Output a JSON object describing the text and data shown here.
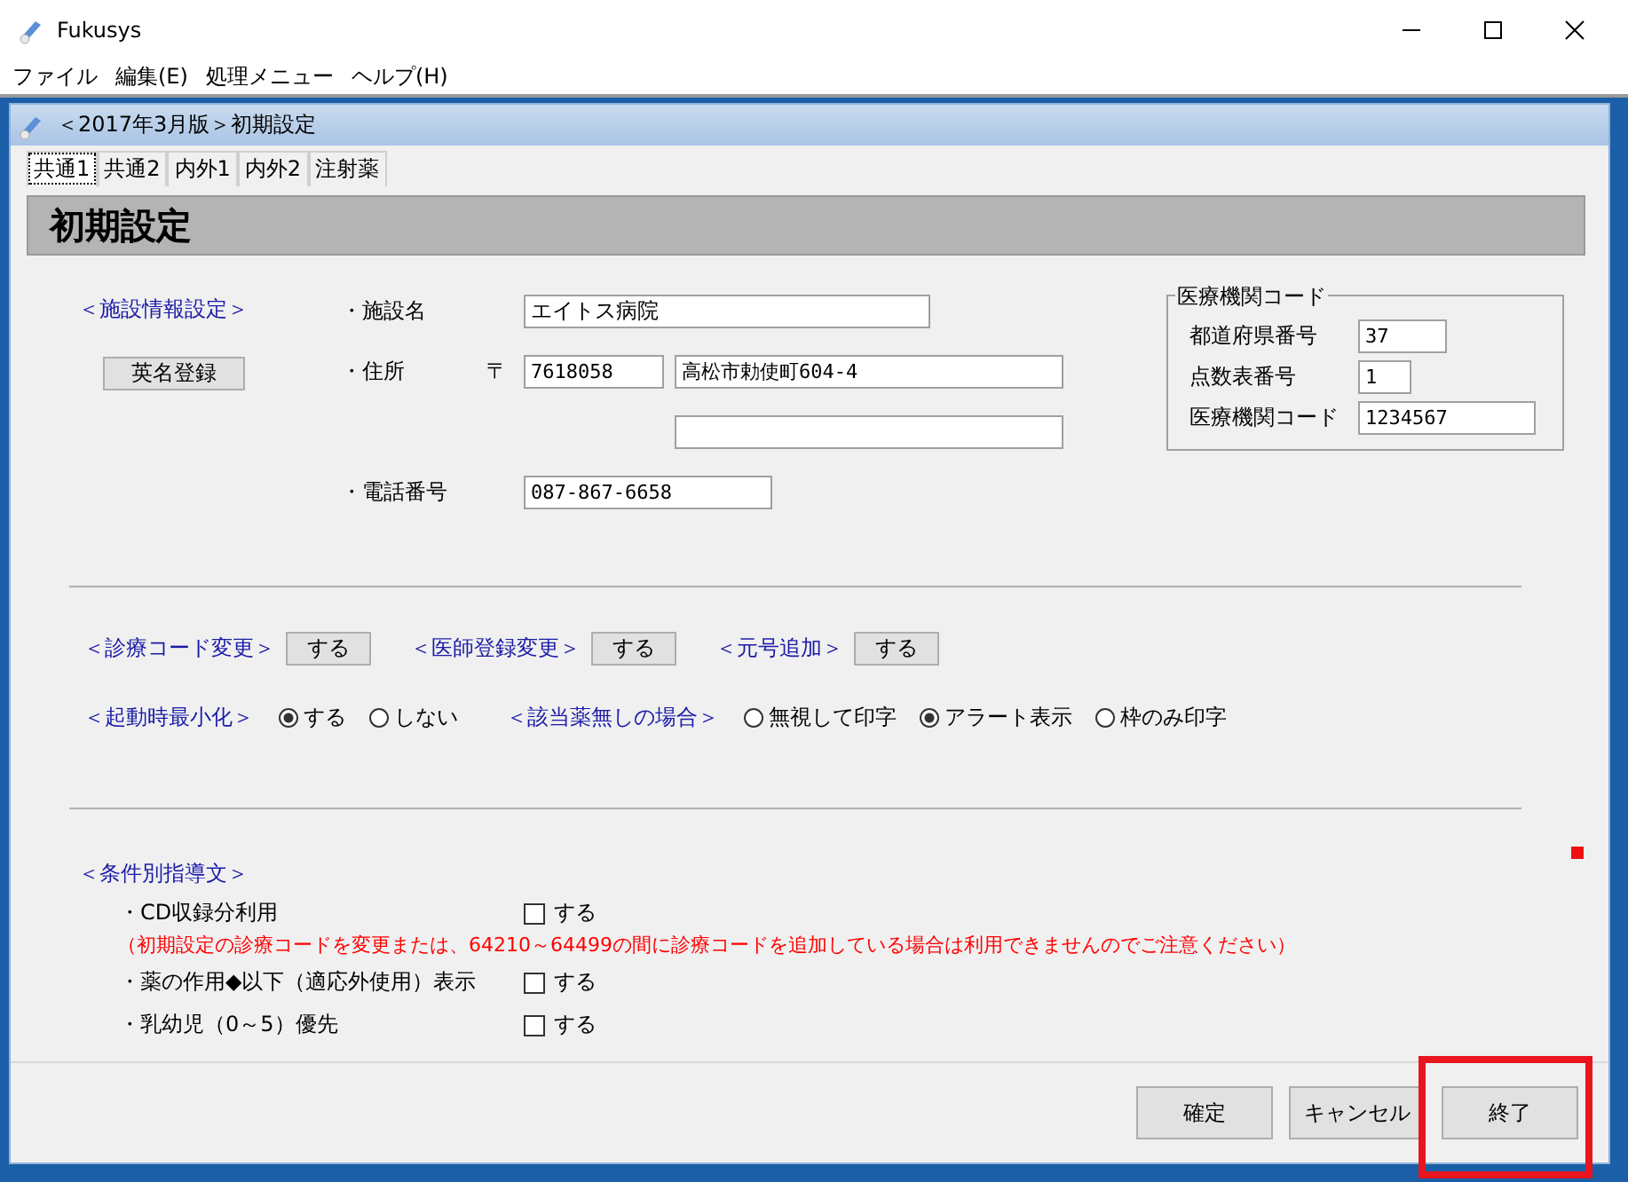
{
  "app": {
    "title": "Fukusys"
  },
  "menu": [
    "ファイル",
    "編集(E)",
    "処理メニュー",
    "ヘルプ(H)"
  ],
  "child_window": {
    "title": "＜2017年3月版＞初期設定"
  },
  "tabs": [
    {
      "label": "共通1",
      "selected": true
    },
    {
      "label": "共通2",
      "selected": false
    },
    {
      "label": "内外1",
      "selected": false
    },
    {
      "label": "内外2",
      "selected": false
    },
    {
      "label": "注射薬",
      "selected": false
    }
  ],
  "header": "初期設定",
  "facility": {
    "section": "＜施設情報設定＞",
    "english_button": "英名登録",
    "name_label": "・施設名",
    "name": "エイトス病院",
    "address_label": "・住所",
    "postal_mark": "〒",
    "postal_code": "7618058",
    "address_1": "高松市勅使町604-4",
    "phone_label": "・電話番号",
    "phone": "087-867-6658"
  },
  "institution_code": {
    "title": "医療機関コード",
    "fields": [
      {
        "label": "都道府県番号",
        "value": "37"
      },
      {
        "label": "点数表番号",
        "value": "1"
      },
      {
        "label": "医療機関コード",
        "value": "1234567"
      }
    ]
  },
  "change_buttons": [
    {
      "label": "＜診療コード変更＞",
      "button": "する"
    },
    {
      "label": "＜医師登録変更＞",
      "button": "する"
    },
    {
      "label": "＜元号追加＞",
      "button": "する"
    }
  ],
  "radio_groups": [
    {
      "label": "＜起動時最小化＞",
      "options": [
        {
          "label": "する",
          "selected": true
        },
        {
          "label": "しない",
          "selected": false
        }
      ]
    },
    {
      "label": "＜該当薬無しの場合＞",
      "options": [
        {
          "label": "無視して印字",
          "selected": false
        },
        {
          "label": "アラート表示",
          "selected": true
        },
        {
          "label": "枠のみ印字",
          "selected": false
        }
      ]
    }
  ],
  "guidance": {
    "section": "＜条件別指導文＞",
    "items": [
      {
        "label": "・CD収録分利用",
        "checkbox": "する",
        "checked": false,
        "note": "（初期設定の診療コードを変更または、64210～64499の間に診療コードを追加している場合は利用できませんのでご注意ください）"
      },
      {
        "label": "・薬の作用◆以下（適応外使用）表示",
        "checkbox": "する",
        "checked": false
      },
      {
        "label": "・乳幼児（0～5）優先",
        "checkbox": "する",
        "checked": false
      }
    ]
  },
  "buttons": [
    {
      "label": "確定",
      "highlighted": false
    },
    {
      "label": "キャンセル",
      "highlighted": false
    },
    {
      "label": "終了",
      "highlighted": true
    }
  ]
}
